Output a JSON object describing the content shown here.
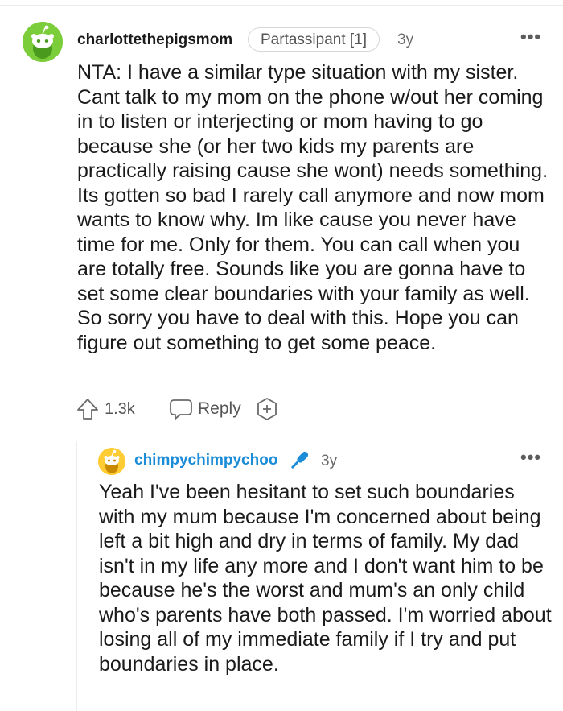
{
  "parent": {
    "username": "charlottethepigsmom",
    "flair": "Partassipant [1]",
    "age": "3y",
    "more": "•••",
    "body": "NTA: I have a similar type situation with my sister. Cant talk to my mom on the phone w/out her coming in to listen or interjecting or mom having to go because she (or her two kids my parents are practically raising cause she wont) needs something. Its gotten so bad I rarely call anymore and now mom wants to know why. Im like cause you never have time for me. Only for them. You can call when you are totally free. Sounds like you are gonna have to set some clear boundaries with your family as well. So sorry you have to deal with this. Hope you can figure out something to get some peace.",
    "votes": "1.3k",
    "reply_label": "Reply",
    "avatar_color": "#7ccd3a"
  },
  "reply": {
    "username": "chimpychimpychoo",
    "age": "3y",
    "more": "•••",
    "body": "Yeah I've been hesitant to set such boundaries with my mum because I'm concerned about being left a bit high and dry in terms of family. My dad isn't in my life any more and I don't want him to be because he's the worst and mum's an only child who's parents have both passed. I'm worried about losing all of my immediate family if I try and put boundaries in place.",
    "avatar_color": "#ffcc33",
    "username_color": "#1a8cd8",
    "badge_icon": "microphone-icon"
  },
  "icons": {
    "upvote": "upvote-arrow-icon",
    "reply": "speech-bubble-icon",
    "award": "add-award-icon",
    "more": "more-options-icon"
  }
}
